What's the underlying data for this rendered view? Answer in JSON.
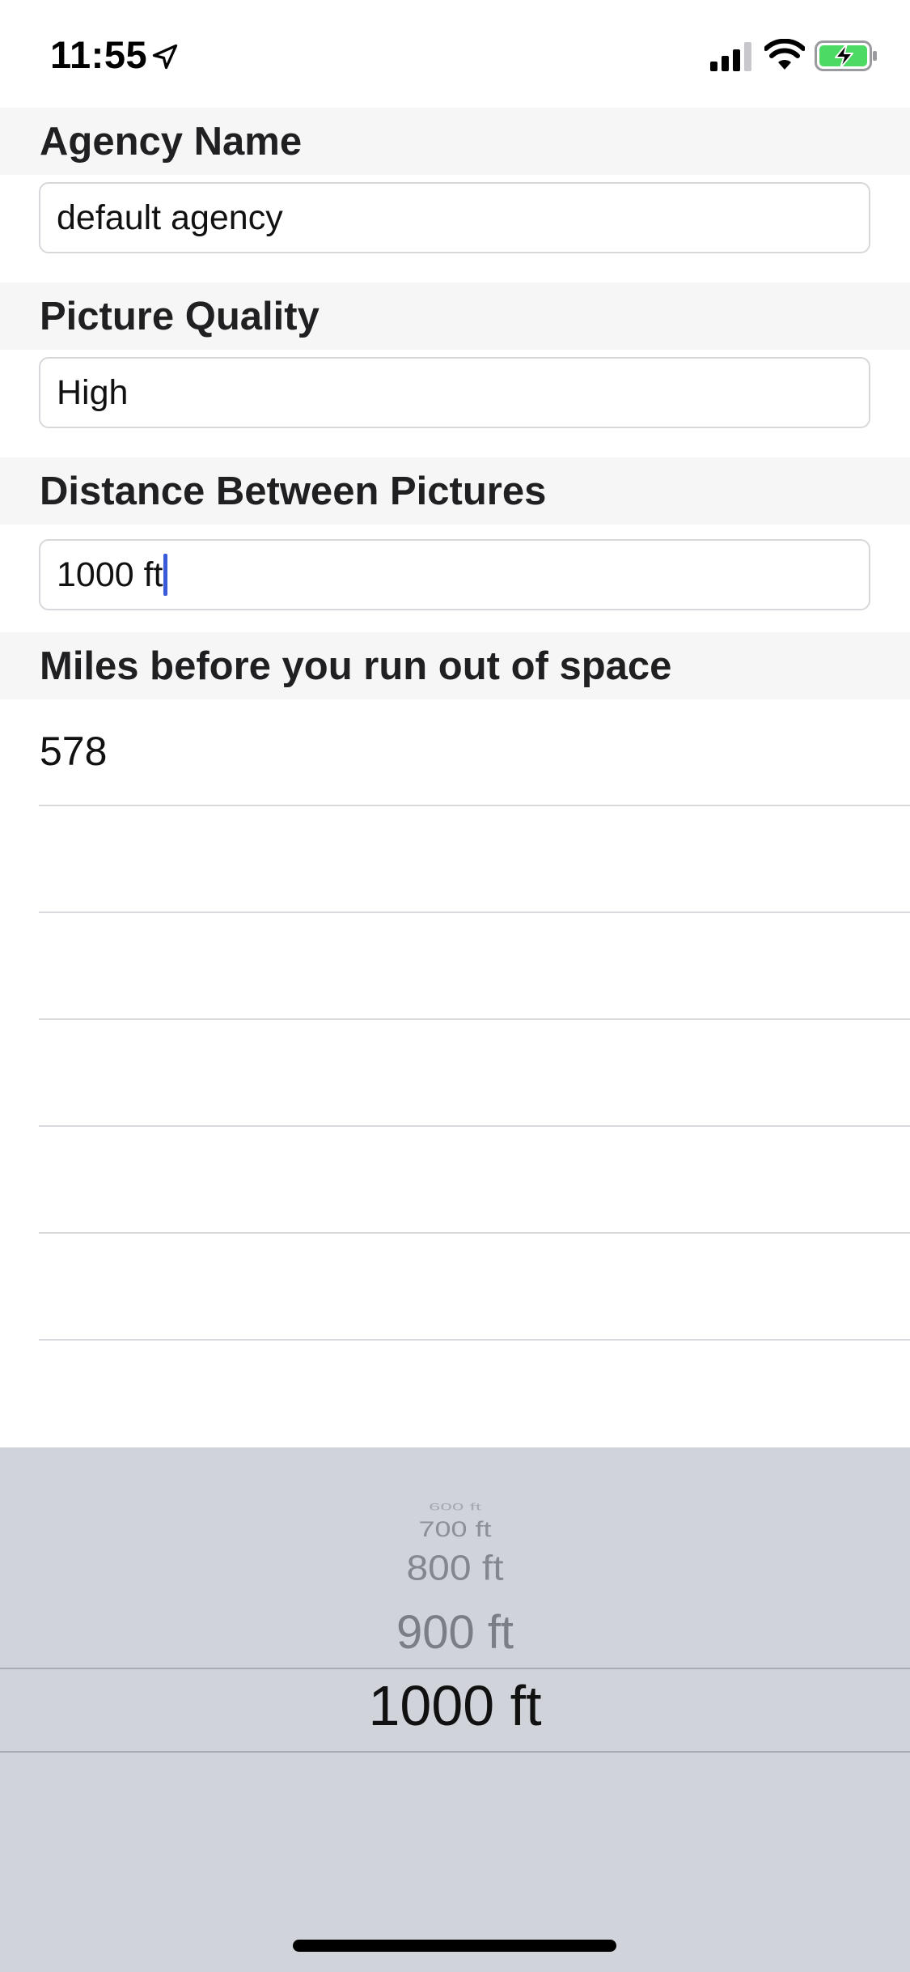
{
  "status_bar": {
    "time": "11:55",
    "icons": [
      "location-arrow-icon",
      "signal-icon",
      "wifi-icon",
      "battery-charging-icon"
    ],
    "battery_color": "#4cd964"
  },
  "sections": {
    "agency": {
      "header": "Agency Name",
      "value": "default agency"
    },
    "quality": {
      "header": "Picture Quality",
      "value": "High"
    },
    "distance": {
      "header": "Distance Between Pictures",
      "value": "1000 ft"
    },
    "miles": {
      "header": "Miles before you run out of space",
      "value": "578"
    }
  },
  "picker": {
    "options": [
      "600 ft",
      "700 ft",
      "800 ft",
      "900 ft",
      "1000 ft"
    ],
    "selected": "1000 ft"
  },
  "colors": {
    "caret": "#3a5bd9",
    "picker_background": "#d0d3da",
    "header_background": "#f6f6f7"
  }
}
